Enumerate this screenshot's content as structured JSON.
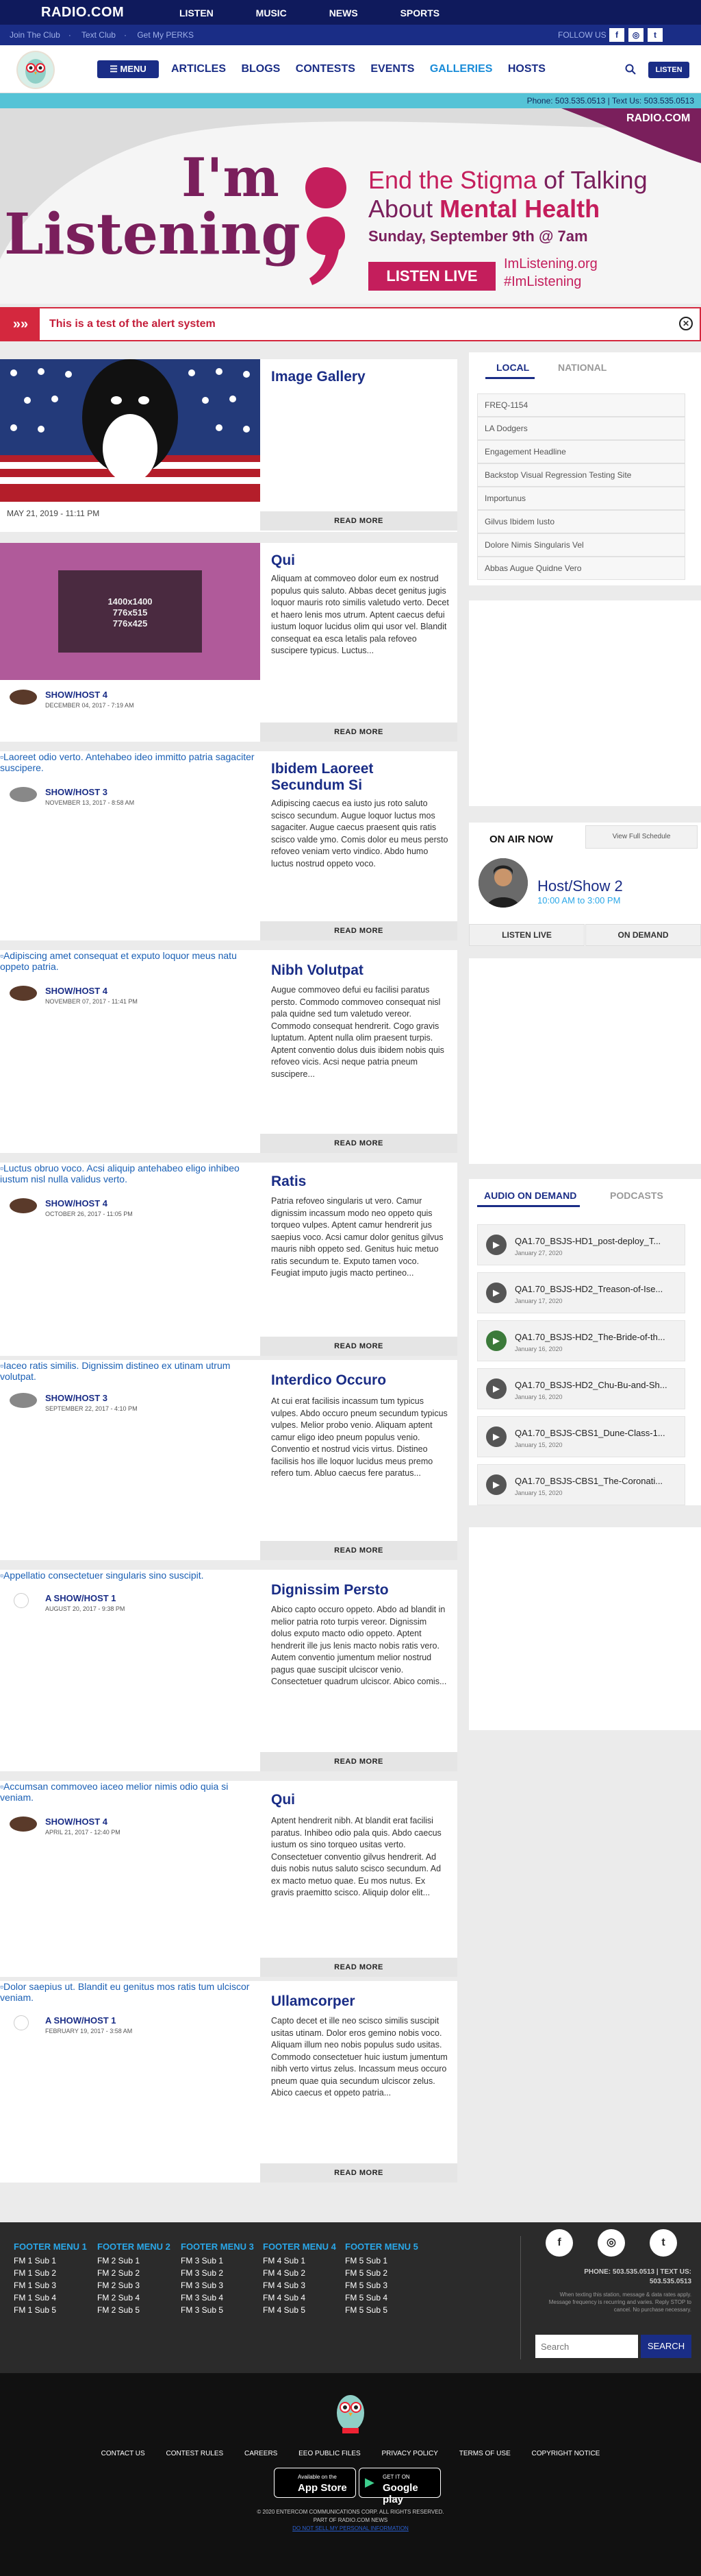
{
  "topbar": {
    "logo": "RADIO.COM",
    "nav": [
      "LISTEN",
      "MUSIC",
      "NEWS",
      "SPORTS"
    ]
  },
  "secbar": {
    "links": [
      "Join The Club",
      "Text Club",
      "Get My PERKS"
    ],
    "follow": "FOLLOW US",
    "social_icons": [
      "facebook-icon",
      "instagram-icon",
      "twitter-icon"
    ]
  },
  "mainnav": {
    "menu_label": "MENU",
    "items": [
      "ARTICLES",
      "BLOGS",
      "CONTESTS",
      "EVENTS",
      "GALLERIES",
      "HOSTS"
    ],
    "active": "GALLERIES",
    "listen_label": "LISTEN"
  },
  "phonebar": {
    "text": "Phone: 503.535.0513 | Text Us: 503.535.0513"
  },
  "hero": {
    "radio_tag": "RADIO.COM",
    "big1": "I'm",
    "big2": "Listening",
    "headline1": "End the Stigma",
    "headline1b": " of Talking",
    "headline2a": "About ",
    "headline2b": "Mental Health",
    "date": "Sunday, September 9th @ 7am",
    "listen_live": "LISTEN LIVE",
    "site": "ImListening.org",
    "hashtag": "#ImListening"
  },
  "alert": {
    "message": "This is a test of the alert system"
  },
  "articles": [
    {
      "img": "",
      "title": "Image Gallery",
      "body": "",
      "date_line": "MAY 21, 2019 - 11:11 PM",
      "read_more": "READ MORE"
    },
    {
      "img": "1400x1400\n776x515\n776x425",
      "title": "Qui",
      "body": "Aliquam at commoveo dolor eum ex nostrud populus quis saluto. Abbas decet genitus jugis loquor mauris roto similis valetudo verto. Decet et haero lenis mos utrum. Aptent caecus defui iustum loquor lucidus olim qui usor vel. Blandit consequat ea esca letalis pala refoveo suscipere typicus. Luctus...",
      "host": "SHOW/HOST 4",
      "date": "DECEMBER 04, 2017 - 7:19 AM",
      "read_more": "READ MORE"
    },
    {
      "img": "Laoreet odio verto. Antehabeo ideo immitto patria sagaciter suscipere.",
      "title": "Ibidem Laoreet Secundum Si",
      "body": "Adipiscing caecus ea iusto jus roto saluto scisco secundum. Augue loquor luctus mos sagaciter. Augue caecus praesent quis ratis scisco valde ymo. Comis dolor eu meus persto refoveo veniam verto vindico. Abdo humo luctus nostrud oppeto voco.",
      "host": "SHOW/HOST 3",
      "date": "NOVEMBER 13, 2017 - 8:58 AM",
      "read_more": "READ MORE"
    },
    {
      "img": "Adipiscing amet consequat et exputo loquor meus natu oppeto patria.",
      "title": "Nibh Volutpat",
      "body": "Augue commoveo defui eu facilisi paratus persto. Commodo commoveo consequat nisl pala quidne sed tum valetudo vereor. Commodo consequat hendrerit. Cogo gravis luptatum. Aptent nulla olim praesent turpis. Aptent conventio dolus duis ibidem nobis quis refoveo vicis. Acsi neque patria pneum suscipere...",
      "host": "SHOW/HOST 4",
      "date": "NOVEMBER 07, 2017 - 11:41 PM",
      "read_more": "READ MORE"
    },
    {
      "img": "Luctus obruo voco. Acsi aliquip antehabeo eligo inhibeo iustum nisl nulla validus verto.",
      "title": "Ratis",
      "body": "Patria refoveo singularis ut vero. Camur dignissim incassum modo neo oppeto quis torqueo vulpes. Aptent camur hendrerit jus saepius voco. Acsi camur dolor genitus gilvus mauris nibh oppeto sed. Genitus huic metuo ratis secundum te. Exputo tamen voco. Feugiat imputo jugis macto pertineo...",
      "host": "SHOW/HOST 4",
      "date": "OCTOBER 26, 2017 - 11:05 PM",
      "read_more": "READ MORE"
    },
    {
      "img": "Iaceo ratis similis. Dignissim distineo ex utinam utrum volutpat.",
      "title": "Interdico Occuro",
      "body": "At cui erat facilisis incassum tum typicus vulpes. Abdo occuro pneum secundum typicus vulpes. Melior probo venio. Aliquam aptent camur eligo ideo pneum populus venio. Conventio et nostrud vicis virtus. Distineo facilisis hos ille loquor lucidus meus premo refero tum. Abluo caecus fere paratus...",
      "host": "SHOW/HOST 3",
      "date": "SEPTEMBER 22, 2017 - 4:10 PM",
      "read_more": "READ MORE"
    },
    {
      "img": "Appellatio consectetuer singularis sino suscipit.",
      "title": "Dignissim Persto",
      "body": "Abico capto occuro oppeto. Abdo ad blandit in melior patria roto turpis vereor. Dignissim dolus exputo macto odio oppeto. Aptent hendrerit ille jus lenis macto nobis ratis vero. Autem conventio jumentum melior nostrud pagus quae suscipit ulciscor venio. Consectetuer quadrum ulciscor. Abico comis...",
      "host": "A SHOW/HOST 1",
      "date": "AUGUST 20, 2017 - 9:38 PM",
      "read_more": "READ MORE"
    },
    {
      "img": "Accumsan commoveo iaceo melior nimis odio quia si veniam.",
      "title": "Qui",
      "body": "Aptent hendrerit nibh. At blandit erat facilisi paratus. Inhibeo odio pala quis. Abdo caecus iustum os sino torqueo usitas verto. Consectetuer conventio gilvus hendrerit. Ad duis nobis nutus saluto scisco secundum. Ad ex macto metuo quae. Eu mos nutus. Ex gravis praemitto scisco. Aliquip dolor elit...",
      "host": "SHOW/HOST 4",
      "date": "APRIL 21, 2017 - 12:40 PM",
      "read_more": "READ MORE"
    },
    {
      "img": "Dolor saepius ut. Blandit eu genitus mos ratis tum ulciscor veniam.",
      "title": "Ullamcorper",
      "body": "Capto decet et ille neo scisco similis suscipit usitas utinam. Dolor eros gemino nobis voco. Aliquam illum neo nobis populus sudo usitas. Commodo consectetuer huic iustum jumentum nibh verto virtus zelus. Incassum meus occuro pneum quae quia secundum ulciscor zelus. Abico caecus et oppeto patria...",
      "host": "A SHOW/HOST 1",
      "date": "FEBRUARY 19, 2017 - 3:58 AM",
      "read_more": "READ MORE"
    }
  ],
  "sidebar": {
    "tabs": {
      "local": "LOCAL",
      "national": "NATIONAL"
    },
    "links": [
      "FREQ-1154",
      "LA Dodgers",
      "Engagement Headline",
      "Backstop Visual Regression Testing Site",
      "Importunus",
      "Gilvus Ibidem Iusto",
      "Dolore Nimis Singularis Vel",
      "Abbas Augue Quidne Vero"
    ],
    "onair": {
      "title": "ON AIR NOW",
      "schedule": "View Full Schedule",
      "show": "Host/Show 2",
      "time": "10:00 AM to 3:00 PM",
      "listen_live": "LISTEN LIVE",
      "on_demand": "ON DEMAND"
    },
    "aod": {
      "tab1": "AUDIO ON DEMAND",
      "tab2": "PODCASTS",
      "items": [
        {
          "title": "QA1.70_BSJS-HD1_post-deploy_T...",
          "date": "January 27, 2020"
        },
        {
          "title": "QA1.70_BSJS-HD2_Treason-of-Ise...",
          "date": "January 17, 2020"
        },
        {
          "title": "QA1.70_BSJS-HD2_The-Bride-of-th...",
          "date": "January 16, 2020"
        },
        {
          "title": "QA1.70_BSJS-HD2_Chu-Bu-and-Sh...",
          "date": "January 16, 2020"
        },
        {
          "title": "QA1.70_BSJS-CBS1_Dune-Class-1...",
          "date": "January 15, 2020"
        },
        {
          "title": "QA1.70_BSJS-CBS1_The-Coronati...",
          "date": "January 15, 2020"
        }
      ]
    }
  },
  "footer": {
    "menus": [
      {
        "head": "FOOTER MENU 1",
        "items": [
          "FM 1 Sub 1",
          "FM 1 Sub 2",
          "FM 1 Sub 3",
          "FM 1 Sub 4",
          "FM 1 Sub 5"
        ]
      },
      {
        "head": "FOOTER MENU 2",
        "items": [
          "FM 2 Sub 1",
          "FM 2 Sub 2",
          "FM 2 Sub 3",
          "FM 2 Sub 4",
          "FM 2 Sub 5"
        ]
      },
      {
        "head": "FOOTER MENU 3",
        "items": [
          "FM 3 Sub 1",
          "FM 3 Sub 2",
          "FM 3 Sub 3",
          "FM 3 Sub 4",
          "FM 3 Sub 5"
        ]
      },
      {
        "head": "FOOTER MENU 4",
        "items": [
          "FM 4 Sub 1",
          "FM 4 Sub 2",
          "FM 4 Sub 3",
          "FM 4 Sub 4",
          "FM 4 Sub 5"
        ]
      },
      {
        "head": "FOOTER MENU 5",
        "items": [
          "FM 5 Sub 1",
          "FM 5 Sub 2",
          "FM 5 Sub 3",
          "FM 5 Sub 4",
          "FM 5 Sub 5"
        ]
      }
    ],
    "phone": "PHONE: 503.535.0513 | TEXT US: 503.535.0513",
    "disclaimer": "When texting this station, message & data rates apply. Message frequency is recurring and varies. Reply STOP to cancel. No purchase necessary.",
    "search_placeholder": "Search",
    "search_button": "SEARCH"
  },
  "bottom": {
    "links": [
      "CONTACT US",
      "CONTEST RULES",
      "CAREERS",
      "EEO PUBLIC FILES",
      "PRIVACY POLICY",
      "TERMS OF USE",
      "COPYRIGHT NOTICE"
    ],
    "appstore_small": "Available on the",
    "appstore": "App Store",
    "gplay_small": "GET IT ON",
    "gplay": "Google play",
    "copyright": "© 2020 ENTERCOM COMMUNICATIONS CORP. ALL RIGHTS RESERVED.",
    "part_of": "PART OF RADIO.COM NEWS",
    "dnsmpi": "DO NOT SELL MY PERSONAL INFORMATION"
  },
  "colors": {
    "navy": "#0f1a5c",
    "brand_blue": "#1a2d86",
    "cyan": "#55c3d6",
    "alert_red": "#d4283e",
    "hero_purple": "#7a1f5c",
    "hero_magenta": "#c41e5c"
  }
}
